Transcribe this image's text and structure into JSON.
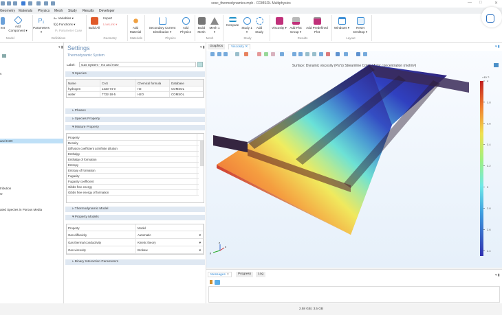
{
  "window": {
    "title": "sosc_thermodynamics.mph - COMSOL Multiphysics"
  },
  "menu": [
    "Geometry",
    "Materials",
    "Physics",
    "Mesh",
    "Study",
    "Results",
    "Developer"
  ],
  "ribbon": {
    "buttons": [
      {
        "label": "ent",
        "icon": "component-icon"
      },
      {
        "label": "Add Component ▾",
        "icon": "add-component-icon"
      },
      {
        "label": "Parameters ▾",
        "icon": "parameters-icon"
      },
      {
        "label": "Build All",
        "icon": "build-all-icon"
      },
      {
        "label": "Add Material",
        "icon": "material-icon"
      },
      {
        "label": "Secondary Current Distribution ▾",
        "icon": "physics-interface-icon"
      },
      {
        "label": "Add Physics",
        "icon": "add-physics-icon"
      },
      {
        "label": "Build Mesh",
        "icon": "build-mesh-icon"
      },
      {
        "label": "Mesh 1 ▾",
        "icon": "mesh-icon"
      },
      {
        "label": "Compute",
        "icon": "compute-icon"
      },
      {
        "label": "Study 1 ▾",
        "icon": "study-icon"
      },
      {
        "label": "Add Study",
        "icon": "add-study-icon"
      },
      {
        "label": "Viscosity ▾",
        "icon": "plot-icon"
      },
      {
        "label": "Add Plot Group ▾",
        "icon": "add-plot-group-icon"
      },
      {
        "label": "Add Predefined Plot",
        "icon": "predefined-plot-icon"
      },
      {
        "label": "Windows ▾",
        "icon": "windows-icon"
      },
      {
        "label": "Reset Desktop ▾",
        "icon": "reset-desktop-icon"
      }
    ],
    "small": {
      "variables": "a= Variables ▾",
      "functions": "f(x) Functions ▾",
      "param_case": "P₁ Parameter Case",
      "import": "Import",
      "livelink": "LiveLink ▾"
    },
    "groups": [
      "Model",
      "Definitions",
      "Geometry",
      "Materials",
      "Physics",
      "Mesh",
      "Study",
      "Results",
      "Layout"
    ]
  },
  "tree": {
    "items": [
      "s",
      "",
      "and H2O",
      "tribution",
      "O",
      "ated Species in Porous Media"
    ],
    "selected": 2
  },
  "settings": {
    "title": "Settings",
    "subtitle": "Thermodynamic System",
    "label_caption": "Label:",
    "label_value": "Gas System - H2 and H2O",
    "species": {
      "title": "Species",
      "headers": [
        "Name",
        "CAS",
        "Chemical formula",
        "Database"
      ],
      "rows": [
        [
          "hydrogen",
          "1333-74-0",
          "H2",
          "COMSOL"
        ],
        [
          "water",
          "7732-18-5",
          "H2O",
          "COMSOL"
        ]
      ]
    },
    "phases": "Phases",
    "species_property": "Species Property",
    "mixture": {
      "title": "Mixture Property",
      "header": "Property",
      "rows": [
        "Density",
        "Diffusion coefficient at infinite dilution",
        "Enthalpy",
        "Enthalpy of formation",
        "Entropy",
        "Entropy of formation",
        "Fugacity",
        "Fugacity coefficient",
        "Gibbs free energy",
        "Gibbs free energy of formation"
      ]
    },
    "thermo_model": "Thermodynamic Model",
    "property_models": {
      "title": "Property Models",
      "headers": [
        "Property",
        "Model"
      ],
      "rows": [
        [
          "Gas diffusivity",
          "Automatic"
        ],
        [
          "Gas thermal conductivity",
          "Kinetic theory"
        ],
        [
          "Gas viscosity",
          "Brokaw"
        ]
      ]
    },
    "binary": "Binary Interaction Parameters"
  },
  "graphics": {
    "tabs": [
      "Graphics",
      "Viscosity"
    ],
    "active_tab": 1,
    "plot_title": "Surface: Dynamic viscosity (Pa*s) Streamline Color: Molar concentration (mol/m³)",
    "colorbar": {
      "scale": "×10⁻⁵",
      "ticks": [
        "4",
        "3.8",
        "3.6",
        "3.4",
        "3.2",
        "3",
        "2.8",
        "2.6",
        "2.4"
      ],
      "min": 2.35,
      "max": 4.0
    },
    "axes": [
      "z",
      "y",
      "x"
    ]
  },
  "messages": {
    "tabs": [
      "Messages",
      "Progress",
      "Log"
    ]
  },
  "status": {
    "memory": "2.58 GB | 3.5 GB"
  }
}
